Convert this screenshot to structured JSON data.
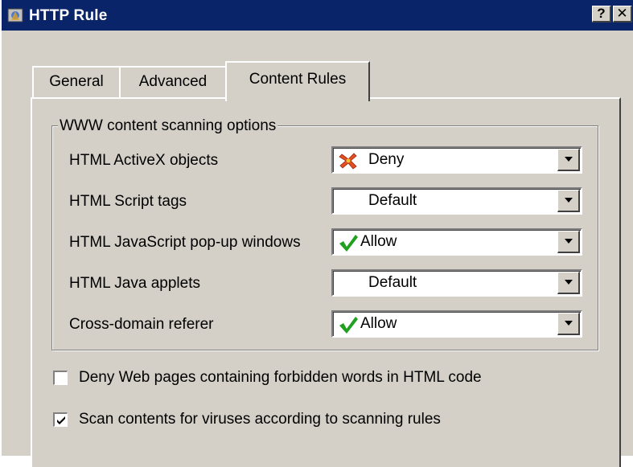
{
  "window": {
    "title": "HTTP Rule",
    "help_label": "?",
    "close_label": "✕"
  },
  "tabs": [
    {
      "label": "General",
      "selected": false
    },
    {
      "label": "Advanced",
      "selected": false
    },
    {
      "label": "Content Rules",
      "selected": true
    }
  ],
  "group": {
    "title": "WWW content scanning options",
    "rows": [
      {
        "label": "HTML ActiveX objects",
        "value": "Deny",
        "icon": "deny-icon"
      },
      {
        "label": "HTML Script tags",
        "value": "Default",
        "icon": ""
      },
      {
        "label": "HTML JavaScript pop-up windows",
        "value": "Allow",
        "icon": "allow-check-icon"
      },
      {
        "label": "HTML Java applets",
        "value": "Default",
        "icon": ""
      },
      {
        "label": "Cross-domain referer",
        "value": "Allow",
        "icon": "allow-check-icon"
      }
    ]
  },
  "options": [
    {
      "label": "Deny Web pages containing forbidden words in HTML code",
      "checked": false
    },
    {
      "label": "Scan contents for viruses according to scanning rules",
      "checked": true
    }
  ],
  "colors": {
    "titlebar": "#0a246a",
    "face": "#d4d0c8",
    "allow": "#1fa01f",
    "deny": "#e05020"
  }
}
